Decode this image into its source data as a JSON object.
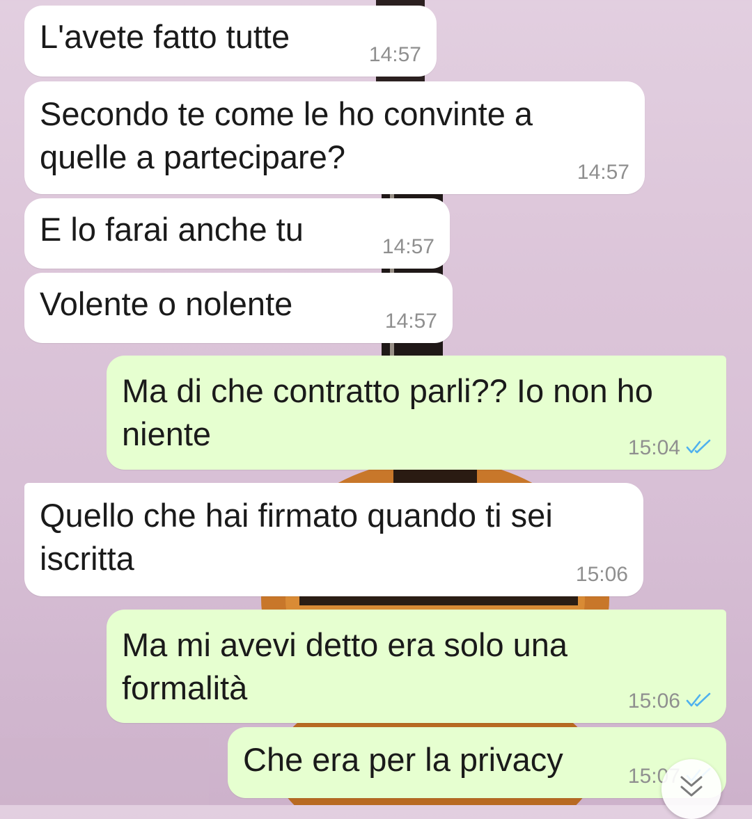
{
  "messages": [
    {
      "direction": "in",
      "text": "L'avete fatto tutte",
      "time": "14:57"
    },
    {
      "direction": "in",
      "text": "Secondo te come le ho convinte a\nquelle a partecipare?",
      "time": "14:57"
    },
    {
      "direction": "in",
      "text": "E lo farai anche tu",
      "time": "14:57"
    },
    {
      "direction": "in",
      "text": "Volente o nolente",
      "time": "14:57"
    },
    {
      "direction": "out",
      "text": "Ma di che contratto parli?? Io non ho\nniente",
      "time": "15:04",
      "status": "read"
    },
    {
      "direction": "in",
      "text": "Quello che hai firmato quando ti sei\niscritta",
      "time": "15:06"
    },
    {
      "direction": "out",
      "text": "Ma mi avevi detto era solo una\nformalità",
      "time": "15:06",
      "status": "read"
    },
    {
      "direction": "out",
      "text": "Che era per la privacy",
      "time": "15:07",
      "status": "read"
    }
  ],
  "colors": {
    "incoming_bubble": "#ffffff",
    "outgoing_bubble": "#e6ffd0",
    "read_ticks": "#4fb1ee",
    "time_text": "#8f8f8f"
  },
  "icons": {
    "read_status": "double-check-icon",
    "scroll_down": "double-chevron-down-icon"
  }
}
